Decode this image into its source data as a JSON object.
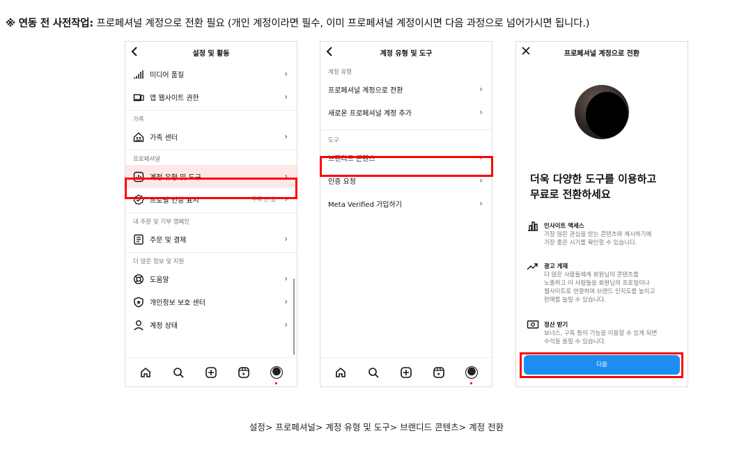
{
  "headline": {
    "bold": "※ 연동 전 사전작업:",
    "rest": " 프로페셔널 계정으로 전환 필요 (개인 계정이라면 필수, 이미 프로페셔널 계정이시면 다음 과정으로 넘어가시면 됩니다.)"
  },
  "screen1": {
    "title": "설정 및 활동",
    "items": [
      {
        "type": "row",
        "icon": "signal-bars-icon",
        "label": "미디어 품질"
      },
      {
        "type": "row",
        "icon": "phone-laptop-icon",
        "label": "앱 웹사이트 권한"
      },
      {
        "type": "section",
        "label": "가족"
      },
      {
        "type": "row",
        "icon": "family-home-icon",
        "label": "가족 센터"
      },
      {
        "type": "section",
        "label": "프로페셔널"
      },
      {
        "type": "row",
        "icon": "chart-box-icon",
        "label": "계정 유형 및 도구",
        "highlight": true
      },
      {
        "type": "row",
        "icon": "verified-badge-icon",
        "label": "프로필 인증 표시",
        "meta": "구독 안 함"
      },
      {
        "type": "section",
        "label": "내 주문 및 기부 캠페인"
      },
      {
        "type": "row",
        "icon": "receipt-icon",
        "label": "주문 및 결제"
      },
      {
        "type": "section",
        "label": "더 많은 정보 및 지원"
      },
      {
        "type": "row",
        "icon": "lifebuoy-icon",
        "label": "도움말"
      },
      {
        "type": "row",
        "icon": "shield-star-icon",
        "label": "개인정보 보호 센터"
      },
      {
        "type": "row",
        "icon": "person-icon",
        "label": "계정 상태"
      }
    ]
  },
  "screen2": {
    "title": "계정 유형 및 도구",
    "section1": "계정 유형",
    "row1": "프로페셔널 계정으로 전환",
    "row2": "새로운 프로페셔널 계정 추가",
    "section2": "도구",
    "row3": "브랜디드 콘텐츠",
    "row4": "인증 요청",
    "row5": "Meta Verified 가입하기"
  },
  "screen3": {
    "title": "프로페셔널 계정으로 전환",
    "headline_line1": "더욱 다양한 도구를 이용하고",
    "headline_line2": "무료로 전환하세요",
    "features": [
      {
        "icon": "insights-chart-icon",
        "title": "인사이트 액세스",
        "desc": "가장 많은 관심을 받는 콘텐츠와 게시하기에\n가장 좋은 시기를 확인할 수 있습니다."
      },
      {
        "icon": "trend-arrow-icon",
        "title": "광고 게재",
        "desc": "더 많은 사람들에게 회원님의 콘텐츠를\n노출하고 이 사람들을 회원님의 프로필이나\n웹사이트로 연결하여 브랜드 인지도를 높이고\n판매를 늘릴 수 있습니다."
      },
      {
        "icon": "cash-icon",
        "title": "정산 받기",
        "desc": "보너스, 구독 등의 기능을 이용할 수 있게 되면\n수익을 올릴 수 있습니다."
      }
    ],
    "next_button": "다음"
  },
  "caption": "설정> 프로페셔널> 계정 유형 및 도구> 브랜디드 콘텐츠> 계정 전환",
  "colors": {
    "highlight": "#ff0000",
    "primary_button": "#1d8ef0"
  }
}
